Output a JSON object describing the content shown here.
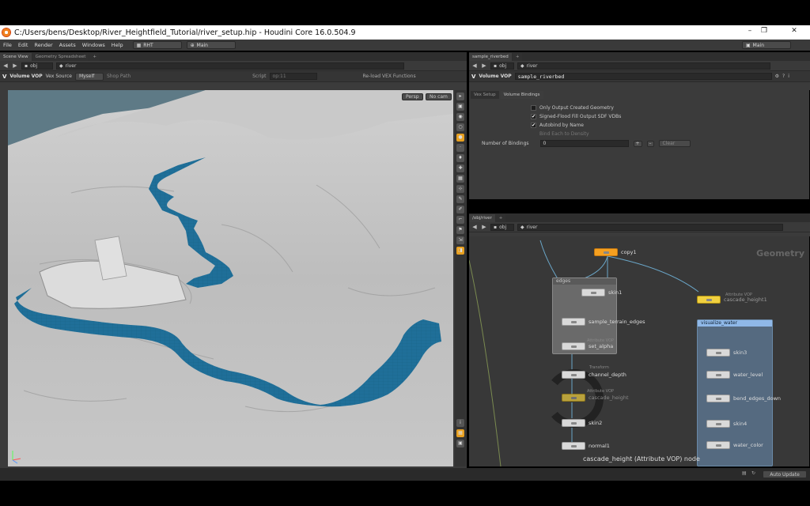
{
  "window": {
    "title": "C:/Users/bens/Desktop/River_Heightfield_Tutorial/river_setup.hip - Houdini Core 16.0.504.9",
    "controls": [
      "–",
      "❐",
      "✕"
    ]
  },
  "menu": {
    "items": [
      "File",
      "Edit",
      "Render",
      "Assets",
      "Windows",
      "Help"
    ],
    "shelf_set": "RHT",
    "desktop": "Main",
    "right_desktop": "Main"
  },
  "left_pane": {
    "tabs": [
      "Scene View",
      "Geometry Spreadsheet"
    ],
    "path": {
      "root": "obj",
      "node": "river"
    },
    "op_toolbar": {
      "type": "Volume VOP",
      "vex_source": "Vex Source",
      "myself": "Myself",
      "shop_path": "Shop Path",
      "script": "Script",
      "script_value": "op:11",
      "reload": "Re-load VEX Functions"
    },
    "viewport": {
      "camera": "Persp",
      "cam_mode": "No cam"
    }
  },
  "parm_pane": {
    "tab": "sample_riverbed",
    "path": {
      "root": "obj",
      "node": "river"
    },
    "header": {
      "type": "Volume VOP",
      "name": "sample_riverbed"
    },
    "sub_tabs": [
      "Vex Setup",
      "Volume Bindings"
    ],
    "checkboxes": [
      {
        "label": "Only Output Created Geometry",
        "checked": false
      },
      {
        "label": "Signed-Flood Fill Output SDF VDBs",
        "checked": true
      },
      {
        "label": "Autobind by Name",
        "checked": true
      },
      {
        "label": "Bind Each to Density",
        "checked": false
      }
    ],
    "bindings": {
      "label": "Number of Bindings",
      "value": "0",
      "clear": "Clear"
    }
  },
  "network": {
    "tab": "/obj/river",
    "path": {
      "root": "obj",
      "node": "river"
    },
    "context": "Geometry",
    "nodes": {
      "copy1": "copy1",
      "edges_box": "edges",
      "skin1": "skin1",
      "sample_terrain_edges": "sample_terrain_edges",
      "set_alpha": "set_alpha",
      "set_alpha_sub": "Attribute VOP",
      "channel_depth": "channel_depth",
      "channel_depth_sub": "Transform",
      "cascade_height": "cascade_height",
      "cascade_height_sub": "Attribute VOP",
      "cascade_height1": "cascade_height1",
      "cascade_height1_sub": "Attribute VOP",
      "skin2": "skin2",
      "normal1": "normal1",
      "visualize_box": "visualize_water",
      "skin3": "skin3",
      "water_level": "water_level",
      "bend_edges_down": "bend_edges_down",
      "skin4": "skin4",
      "water_color": "water_color"
    },
    "info": "cascade_height (Attribute VOP) node"
  },
  "status": {
    "auto_update": "Auto Update"
  },
  "colors": {
    "water": "#1f6f99",
    "terrain": "#b8b8b8",
    "node_orange": "#f5a020",
    "visualize_header": "#8fb8e8"
  }
}
